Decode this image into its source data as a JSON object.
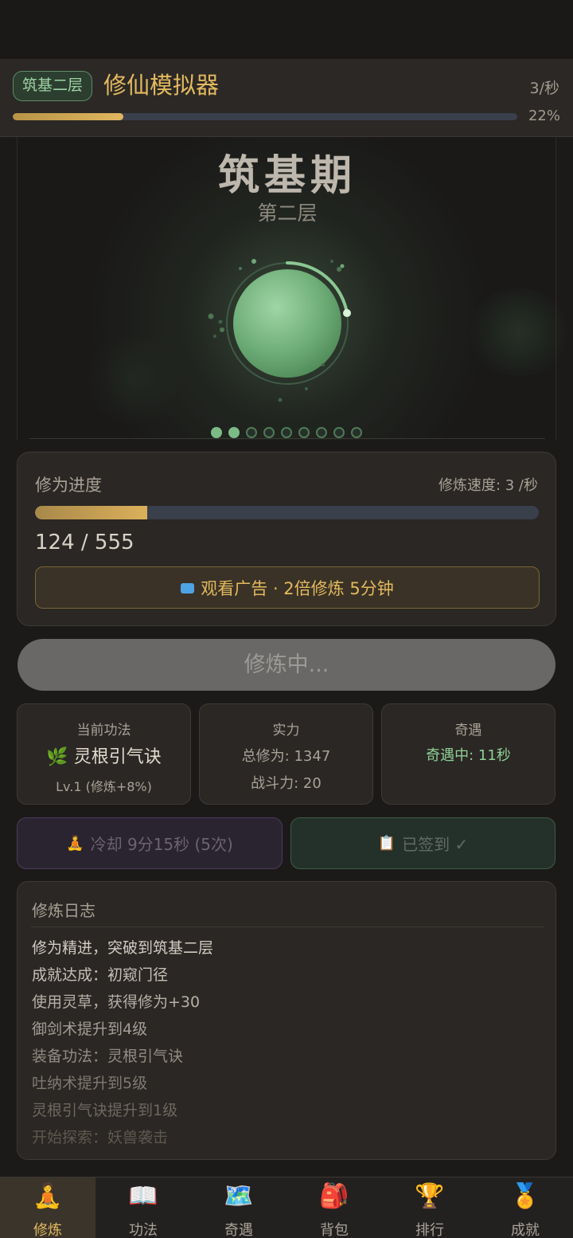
{
  "header": {
    "realm_badge": "筑基二层",
    "title": "修仙模拟器",
    "rate": "3/秒",
    "progress_fraction": 0.22,
    "progress_label": "22%"
  },
  "scene": {
    "realm_name": "筑基期",
    "realm_layer": "第二层",
    "page_dots_total": 9,
    "page_dots_active": 2
  },
  "progress": {
    "title": "修为进度",
    "speed": "修炼速度: 3 /秒",
    "current": 124,
    "max": 555,
    "value_text": "124 / 555",
    "ad_button": "观看广告 · 2倍修炼 5分钟",
    "ad_icon": "tv-icon"
  },
  "cultivate_button": "修炼中...",
  "stats": {
    "technique": {
      "heading": "当前功法",
      "icon": "🌿",
      "name": "灵根引气诀",
      "level": "Lv.1 (修炼+8%)"
    },
    "power": {
      "heading": "实力",
      "total": "总修为: 1347",
      "combat": "战斗力: 20"
    },
    "encounter": {
      "heading": "奇遇",
      "status": "奇遇中: 11秒"
    }
  },
  "actions": {
    "cooldown_icon": "🧘",
    "cooldown": "冷却 9分15秒 (5次)",
    "signin_icon": "📋",
    "signin": "已签到 ✓"
  },
  "log": {
    "title": "修炼日志",
    "entries": [
      "修为精进，突破到筑基二层",
      "成就达成：初窥门径",
      "使用灵草，获得修为+30",
      "御剑术提升到4级",
      "装备功法：灵根引气诀",
      "吐纳术提升到5级",
      "灵根引气诀提升到1级",
      "开始探索：妖兽袭击"
    ]
  },
  "tabs": [
    {
      "label": "修炼",
      "icon": "🧘"
    },
    {
      "label": "功法",
      "icon": "📖"
    },
    {
      "label": "奇遇",
      "icon": "🗺️"
    },
    {
      "label": "背包",
      "icon": "🎒"
    },
    {
      "label": "排行",
      "icon": "🏆"
    },
    {
      "label": "成就",
      "icon": "🏅"
    }
  ],
  "colors": {
    "accent_gold": "#e3b95f",
    "accent_green": "#8fcf96",
    "background": "#1c1a18"
  }
}
